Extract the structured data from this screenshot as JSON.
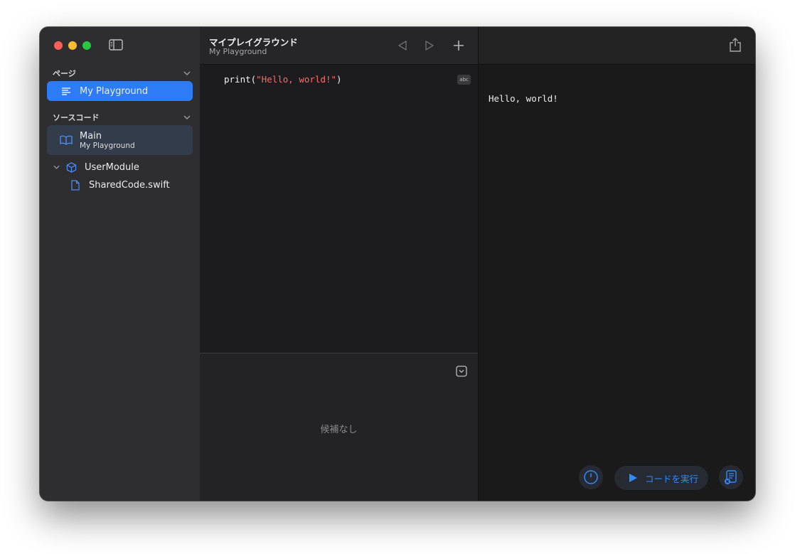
{
  "sidebar": {
    "pages_section": "ページ",
    "pages": [
      {
        "label": "My Playground"
      }
    ],
    "source_section": "ソースコード",
    "main_item": {
      "label": "Main",
      "sub": "My Playground"
    },
    "module": {
      "label": "UserModule"
    },
    "file": {
      "label": "SharedCode.swift"
    }
  },
  "editor": {
    "title": "マイプレイグラウンド",
    "subtitle": "My Playground",
    "code_fn": "print(",
    "code_str": "\"Hello, world!\"",
    "code_end": ")",
    "abc_label": "abc",
    "no_candidates": "候補なし"
  },
  "output": {
    "console_text": "Hello, world!",
    "run_label": "コードを実行"
  },
  "colors": {
    "accent": "#2d7cf6",
    "string": "#ff6b63",
    "run": "#2f8bff"
  }
}
